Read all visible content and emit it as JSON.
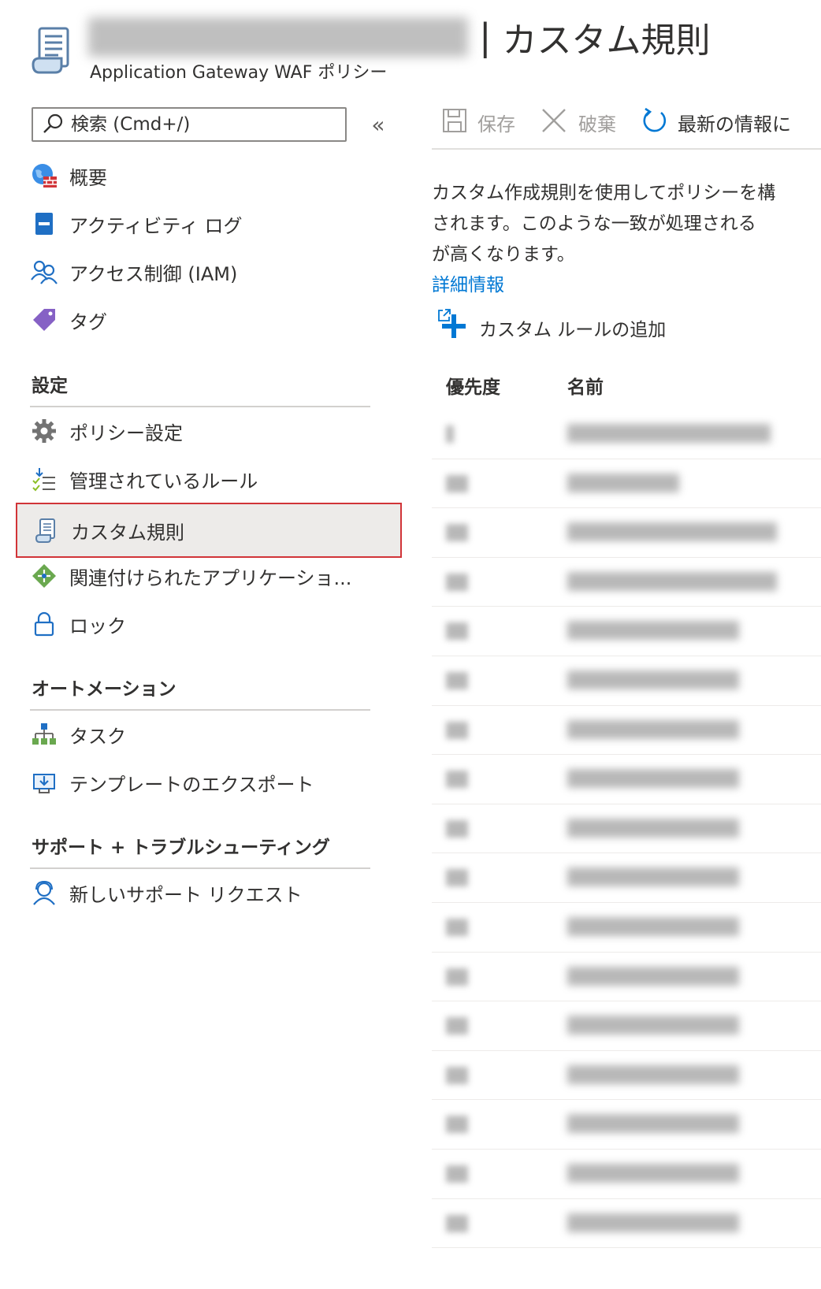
{
  "header": {
    "resource_name": "customer-x-waf-policy",
    "separator": "|",
    "title": "カスタム規則",
    "subtitle": "Application Gateway WAF ポリシー"
  },
  "sidebar": {
    "search_placeholder": "検索 (Cmd+/)",
    "collapse_label": "«",
    "items_top": [
      {
        "label": "概要",
        "icon": "globe-firewall-icon"
      },
      {
        "label": "アクティビティ ログ",
        "icon": "activity-log-icon"
      },
      {
        "label": "アクセス制御 (IAM)",
        "icon": "people-icon"
      },
      {
        "label": "タグ",
        "icon": "tag-icon"
      }
    ],
    "sections": [
      {
        "title": "設定",
        "items": [
          {
            "label": "ポリシー設定",
            "icon": "gear-icon"
          },
          {
            "label": "管理されているルール",
            "icon": "checklist-icon"
          },
          {
            "label": "カスタム規則",
            "icon": "scroll-icon",
            "selected": true
          },
          {
            "label": "関連付けられたアプリケーショ...",
            "icon": "network-diamond-icon"
          },
          {
            "label": "ロック",
            "icon": "lock-icon"
          }
        ]
      },
      {
        "title": "オートメーション",
        "items": [
          {
            "label": "タスク",
            "icon": "task-hierarchy-icon"
          },
          {
            "label": "テンプレートのエクスポート",
            "icon": "export-template-icon"
          }
        ]
      },
      {
        "title": "サポート + トラブルシューティング",
        "items": [
          {
            "label": "新しいサポート リクエスト",
            "icon": "support-person-icon"
          }
        ]
      }
    ]
  },
  "toolbar": {
    "save_label": "保存",
    "discard_label": "破棄",
    "refresh_label": "最新の情報に"
  },
  "main": {
    "description_lines": [
      "カスタム作成規則を使用してポリシーを構",
      "されます。このような一致が処理される",
      "が高くなります。"
    ],
    "learn_more": "詳細情報",
    "add_rule": "カスタム ルールの追加",
    "columns": {
      "priority": "優先度",
      "name": "名前"
    },
    "row_count": 17
  },
  "colors": {
    "accent": "#0078d4",
    "selection_border": "#d13438",
    "selected_bg": "#edebe9"
  }
}
